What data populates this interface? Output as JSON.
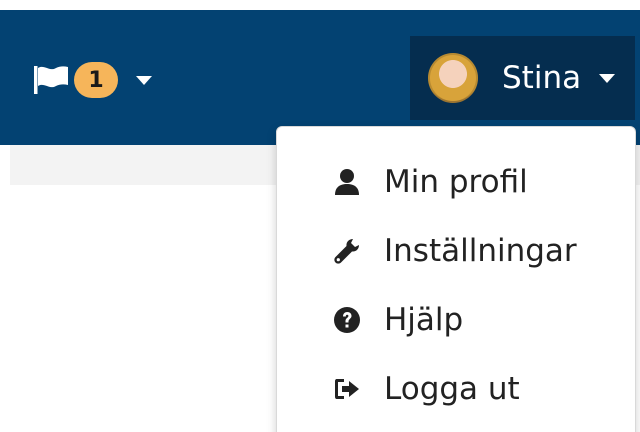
{
  "colors": {
    "navbar": "#034272",
    "user_toggle": "#052d4f",
    "badge": "#f6b55a",
    "subbar": "#f3f3f3",
    "menu_text": "#222222"
  },
  "notifications": {
    "icon": "flag-icon",
    "count": "1"
  },
  "user": {
    "name": "Stina",
    "avatar": "avatar"
  },
  "menu": {
    "items": [
      {
        "label": "Min profil",
        "icon": "user-icon"
      },
      {
        "label": "Inställningar",
        "icon": "wrench-icon"
      },
      {
        "label": "Hjälp",
        "icon": "question-circle-icon"
      },
      {
        "label": "Logga ut",
        "icon": "sign-out-icon"
      }
    ]
  }
}
